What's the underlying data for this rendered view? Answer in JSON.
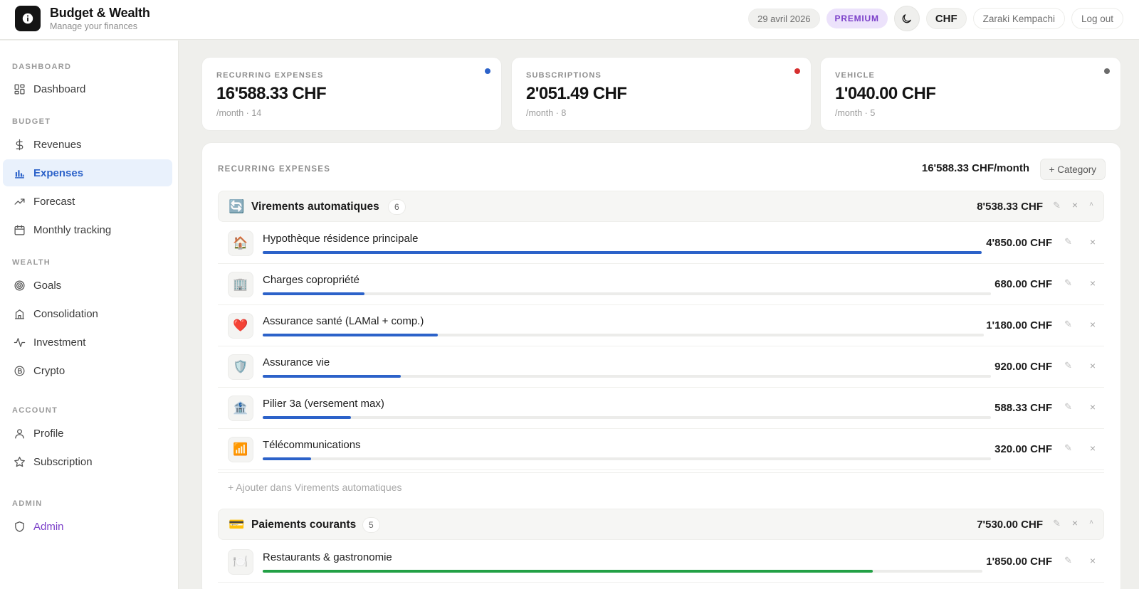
{
  "header": {
    "title": "Budget & Wealth",
    "subtitle": "Manage your finances",
    "date": "29 avril 2026",
    "plan": "PREMIUM",
    "currency": "CHF",
    "user": "Zaraki Kempachi",
    "logout": "Log out"
  },
  "sidebar": {
    "sections": {
      "dashboard": "DASHBOARD",
      "budget": "BUDGET",
      "wealth": "WEALTH",
      "account": "ACCOUNT",
      "admin": "ADMIN"
    },
    "items": {
      "dashboard": "Dashboard",
      "revenues": "Revenues",
      "expenses": "Expenses",
      "forecast": "Forecast",
      "monthly": "Monthly tracking",
      "goals": "Goals",
      "consolidation": "Consolidation",
      "investment": "Investment",
      "crypto": "Crypto",
      "profile": "Profile",
      "subscription": "Subscription",
      "admin": "Admin"
    },
    "active": "expenses"
  },
  "cards": [
    {
      "label": "RECURRING EXPENSES",
      "value": "16'588.33 CHF",
      "sub": "/month · 14",
      "dot_color": "#2c62c9"
    },
    {
      "label": "SUBSCRIPTIONS",
      "value": "2'051.49 CHF",
      "sub": "/month · 8",
      "dot_color": "#d62f2f"
    },
    {
      "label": "VEHICLE",
      "value": "1'040.00 CHF",
      "sub": "/month · 5",
      "dot_color": "#6b6b6b"
    }
  ],
  "panel": {
    "title": "RECURRING EXPENSES",
    "total": "16'588.33 CHF/month",
    "add_category": "+ Category",
    "groups": [
      {
        "emoji": "🔄",
        "name": "Virements automatiques",
        "count": "6",
        "total": "8'538.33 CHF",
        "add_label": "+ Ajouter dans Virements automatiques",
        "items": [
          {
            "emoji": "🏠",
            "name": "Hypothèque résidence principale",
            "amount": "4'850.00 CHF",
            "fraction": 1.0
          },
          {
            "emoji": "🏢",
            "name": "Charges copropriété",
            "amount": "680.00 CHF",
            "fraction": 0.14
          },
          {
            "emoji": "❤️",
            "name": "Assurance santé (LAMal + comp.)",
            "amount": "1'180.00 CHF",
            "fraction": 0.243
          },
          {
            "emoji": "🛡️",
            "name": "Assurance vie",
            "amount": "920.00 CHF",
            "fraction": 0.19
          },
          {
            "emoji": "🏦",
            "name": "Pilier 3a (versement max)",
            "amount": "588.33 CHF",
            "fraction": 0.121
          },
          {
            "emoji": "📶",
            "name": "Télécommunications",
            "amount": "320.00 CHF",
            "fraction": 0.066
          }
        ]
      },
      {
        "emoji": "💳",
        "name": "Paiements courants",
        "count": "5",
        "total": "7'530.00 CHF",
        "items": [
          {
            "emoji": "🍽️",
            "name": "Restaurants & gastronomie",
            "amount": "1'850.00 CHF",
            "fraction": 0.848
          }
        ]
      }
    ]
  },
  "colors": {
    "accent_blue": "#2c62c9",
    "accent_green": "#22a045",
    "premium_purple": "#7b3fc9"
  }
}
